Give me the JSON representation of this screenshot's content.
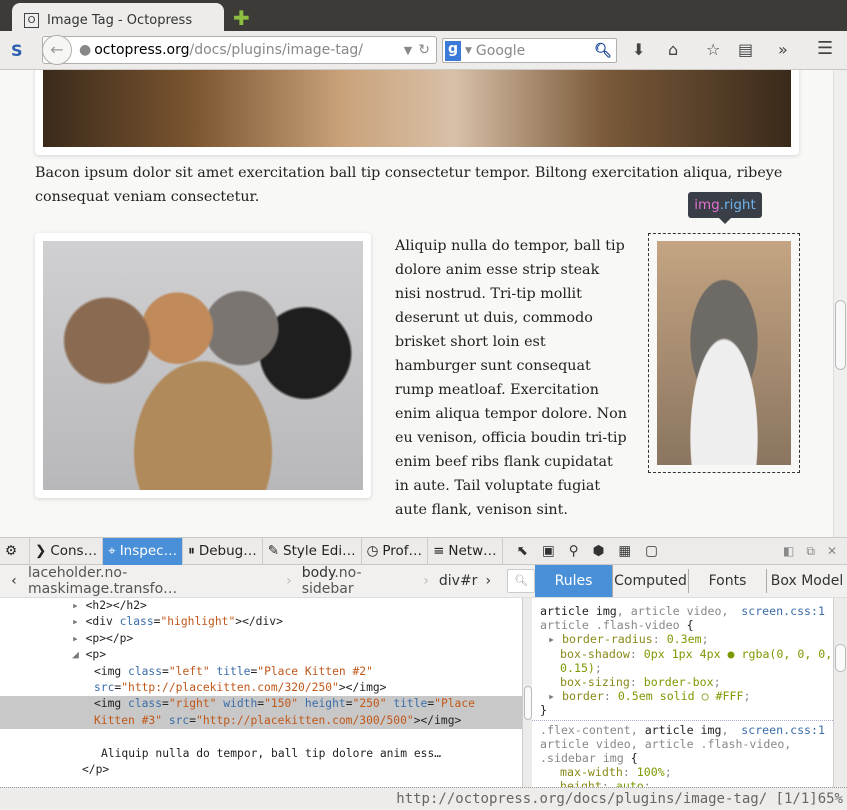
{
  "browser": {
    "tab_title": "Image Tag - Octopress",
    "tab_favicon": "O",
    "url_domain": "octopress.org",
    "url_path": "/docs/plugins/image-tag/",
    "search_placeholder": "Google"
  },
  "page": {
    "paragraph1": "Bacon ipsum dolor sit amet exercitation ball tip consectetur tempor. Biltong exercitation aliqua, ribeye consequat veniam consectetur.",
    "paragraph2": "Aliquip nulla do tempor, ball tip dolore anim esse strip steak nisi nostrud. Tri-tip mollit deserunt ut duis, commodo brisket short loin est hamburger sunt consequat rump meatloaf. Exercitation enim aliqua tempor dolore. Non eu venison, officia boudin tri-tip enim beef ribs flank cupidatat in aute. Tail voluptate fugiat aute flank, venison sint.",
    "tooltip": {
      "tag": "img",
      "cls": ".right"
    }
  },
  "devtools": {
    "tabs": [
      "Cons…",
      "Inspec…",
      "Debug…",
      "Style Edi…",
      "Prof…",
      "Netw…"
    ],
    "breadcrumbs": [
      {
        "tag": "",
        "cls": "laceholder.no-maskimage.transfo…"
      },
      {
        "tag": "body",
        "cls": ".no-sidebar"
      },
      {
        "tag": "div#r",
        "cls": ""
      }
    ],
    "side_tabs": [
      "Rules",
      "Computed",
      "Fonts",
      "Box Model"
    ],
    "markup": {
      "l1": "<h2></h2>",
      "l2a": "<div ",
      "l2b": "class",
      "l2c": "\"highlight\"",
      "l2d": "></div>",
      "l3": "<p></p>",
      "l4": "<p>",
      "l5": [
        "<img ",
        "class",
        "=",
        "\"left\"",
        " title",
        "=",
        "\"Place Kitten #2\""
      ],
      "l6": [
        "src",
        "=",
        "\"http://placekitten.com/320/250\"",
        "></img>"
      ],
      "l7": [
        "<img ",
        "class",
        "=",
        "\"right\"",
        " width",
        "=",
        "\"150\"",
        " height",
        "=",
        "\"250\"",
        " title",
        "=",
        "\"Place"
      ],
      "l8": [
        "Kitten #3\"",
        " src",
        "=",
        "\"http://placekitten.com/300/500\"",
        "></img>"
      ],
      "l9": "Aliquip nulla do tempor, ball tip dolore anim ess…",
      "l10": "</p>"
    },
    "rules": {
      "r1_sel_main": "article img",
      "r1_sel_rest": ", article video, article .flash-video ",
      "r1_src": "screen.css:1",
      "r1_props": [
        [
          "border-radius",
          "0.3em"
        ],
        [
          "box-shadow",
          "0px 1px 4px ● rgba(0, 0, 0, 0.15)"
        ],
        [
          "box-sizing",
          "border-box"
        ],
        [
          "border",
          "0.5em solid ○ #FFF"
        ]
      ],
      "r2_sel_a": ".flex-content, ",
      "r2_sel_main": "article img",
      "r2_sel_rest": ", article video, article .flash-video, .sidebar img ",
      "r2_src": "screen.css:1",
      "r2_props": [
        [
          "max-width",
          "100%"
        ],
        [
          "height",
          "auto"
        ]
      ]
    }
  },
  "status": "http://octopress.org/docs/plugins/image-tag/ [1/1]65%"
}
